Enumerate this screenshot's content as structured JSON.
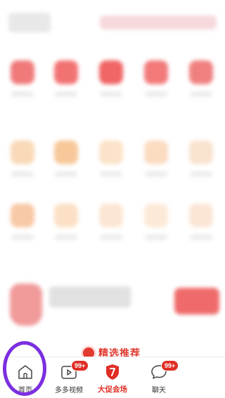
{
  "section": {
    "title": "精选推荐"
  },
  "tabbar": {
    "items": [
      {
        "label": "首页",
        "icon": "home-icon",
        "active": false
      },
      {
        "label": "多多视频",
        "icon": "video-icon",
        "badge": "99+",
        "active": false
      },
      {
        "label": "大促会场",
        "icon": "promo-shield-icon",
        "active": true
      },
      {
        "label": "聊天",
        "icon": "chat-icon",
        "badge": "99+",
        "active": false
      }
    ]
  },
  "colors": {
    "accent": "#e02e24",
    "highlight_ring": "#7b2fe0"
  }
}
